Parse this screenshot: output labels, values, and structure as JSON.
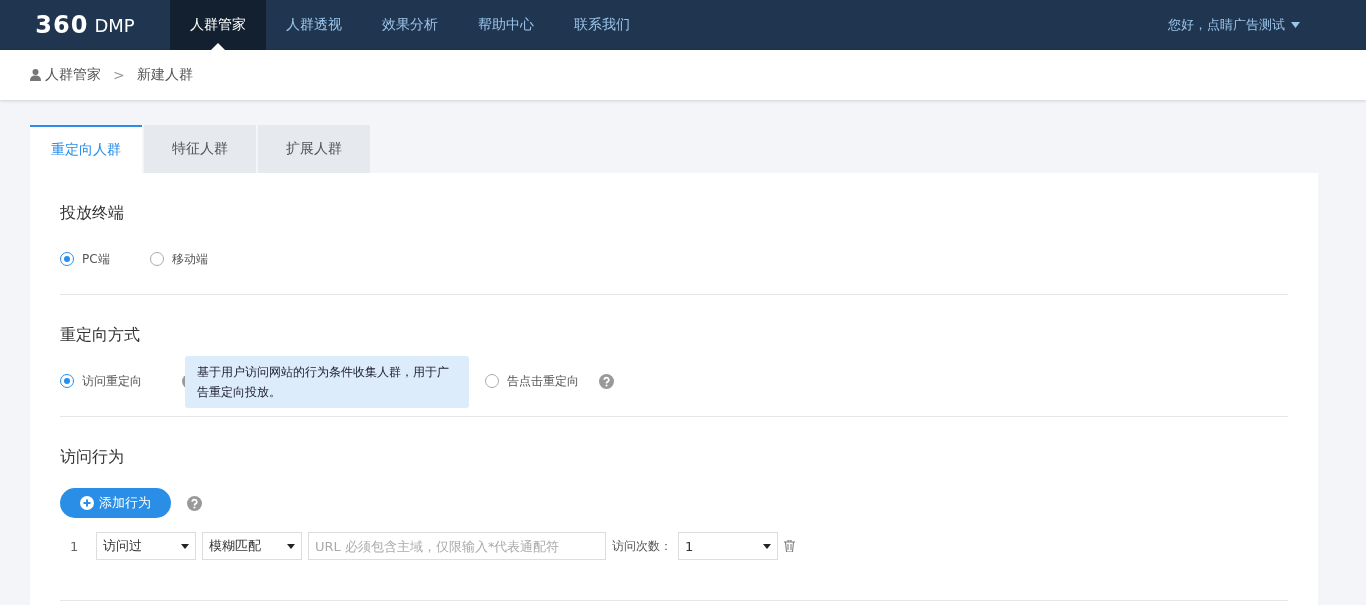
{
  "header": {
    "logo": "360",
    "logo_suffix": "DMP",
    "nav": [
      {
        "label": "人群管家",
        "selected": true
      },
      {
        "label": "人群透视",
        "selected": false
      },
      {
        "label": "效果分析",
        "selected": false
      },
      {
        "label": "帮助中心",
        "selected": false
      },
      {
        "label": "联系我们",
        "selected": false
      }
    ],
    "user": "您好，点睛广告测试"
  },
  "breadcrumb": [
    "人群管家",
    "新建人群"
  ],
  "breadcrumb_separator": ">",
  "tabs": [
    {
      "label": "重定向人群",
      "selected": true
    },
    {
      "label": "特征人群",
      "selected": false
    },
    {
      "label": "扩展人群",
      "selected": false
    }
  ],
  "terminal": {
    "title": "投放终端",
    "options": [
      {
        "label": "PC端",
        "selected": true
      },
      {
        "label": "移动端",
        "selected": false
      }
    ]
  },
  "retarget": {
    "title": "重定向方式",
    "options": [
      {
        "label": "访问重定向",
        "selected": true
      },
      {
        "label": "告点击重定向",
        "selected": false
      }
    ],
    "tooltip": "基于用户访问网站的行为条件收集人群，用于广告重定向投放。"
  },
  "behavior": {
    "title": "访问行为",
    "add_button": "添加行为",
    "rows": [
      {
        "index": "1",
        "action": "访问过",
        "match": "模糊匹配",
        "placeholder": "URL 必须包含主域，仅限输入*代表通配符",
        "count_label": "访问次数：",
        "count": "1"
      }
    ]
  }
}
